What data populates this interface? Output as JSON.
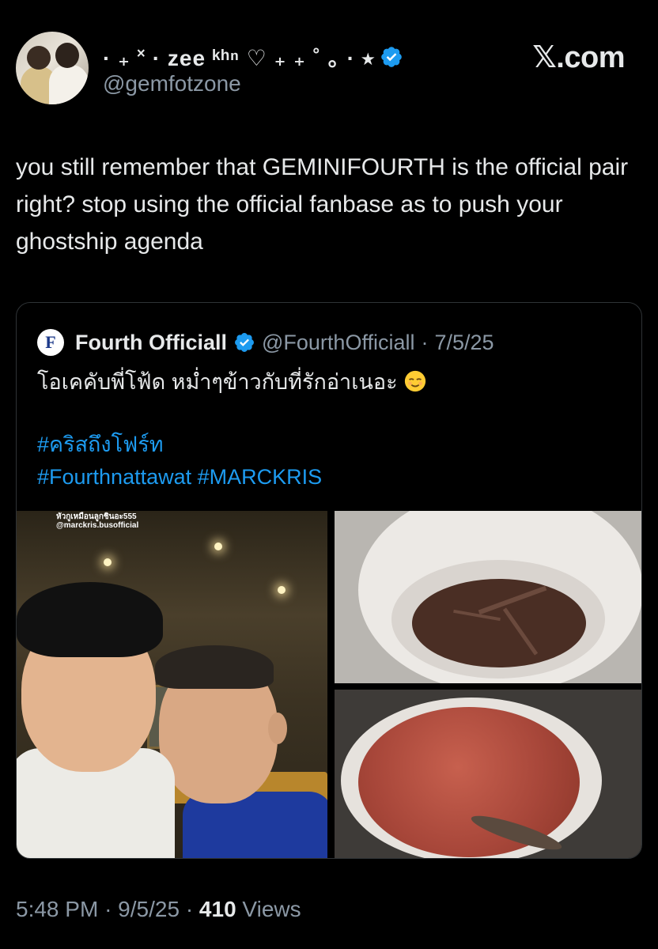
{
  "author": {
    "display_name": "· ₊ ˟ · zee ᵏʰⁿ ♡ ₊ ₊ ˚ ｡ · ⭑",
    "handle": "@gemfotzone",
    "verified": true
  },
  "brand": {
    "label": "𝕏.com"
  },
  "tweet": {
    "text": "you still remember that GEMINIFOURTH is the official pair right? stop using the official fanbase as to push your ghostship agenda"
  },
  "quote": {
    "avatar_letter": "F",
    "name": "Fourth Officiall",
    "handle": "@FourthOfficiall",
    "separator": "·",
    "date": "7/5/25",
    "text": "โอเคคับพี่โฟ้ด หม่ำๆข้าวกับที่รักอ่าเนอะ",
    "emoji_icon": "relieved-face-emoji",
    "hashtags_line1": "#คริสถึงโฟร์ท",
    "hashtags_line2": "#Fourthnattawat #MARCKRIS",
    "photo_caption_line1": "หัวกูเหมือนลูกชินอะ555",
    "photo_caption_line2": "@marckris.busofficial"
  },
  "footer": {
    "time": "5:48 PM",
    "sep1": "·",
    "date": "9/5/25",
    "sep2": "·",
    "views_count": "410",
    "views_label": "Views"
  },
  "colors": {
    "background": "#000000",
    "text": "#e7e9ea",
    "muted": "#8b98a5",
    "link": "#1d9bf0",
    "verified": "#1d9bf0"
  }
}
